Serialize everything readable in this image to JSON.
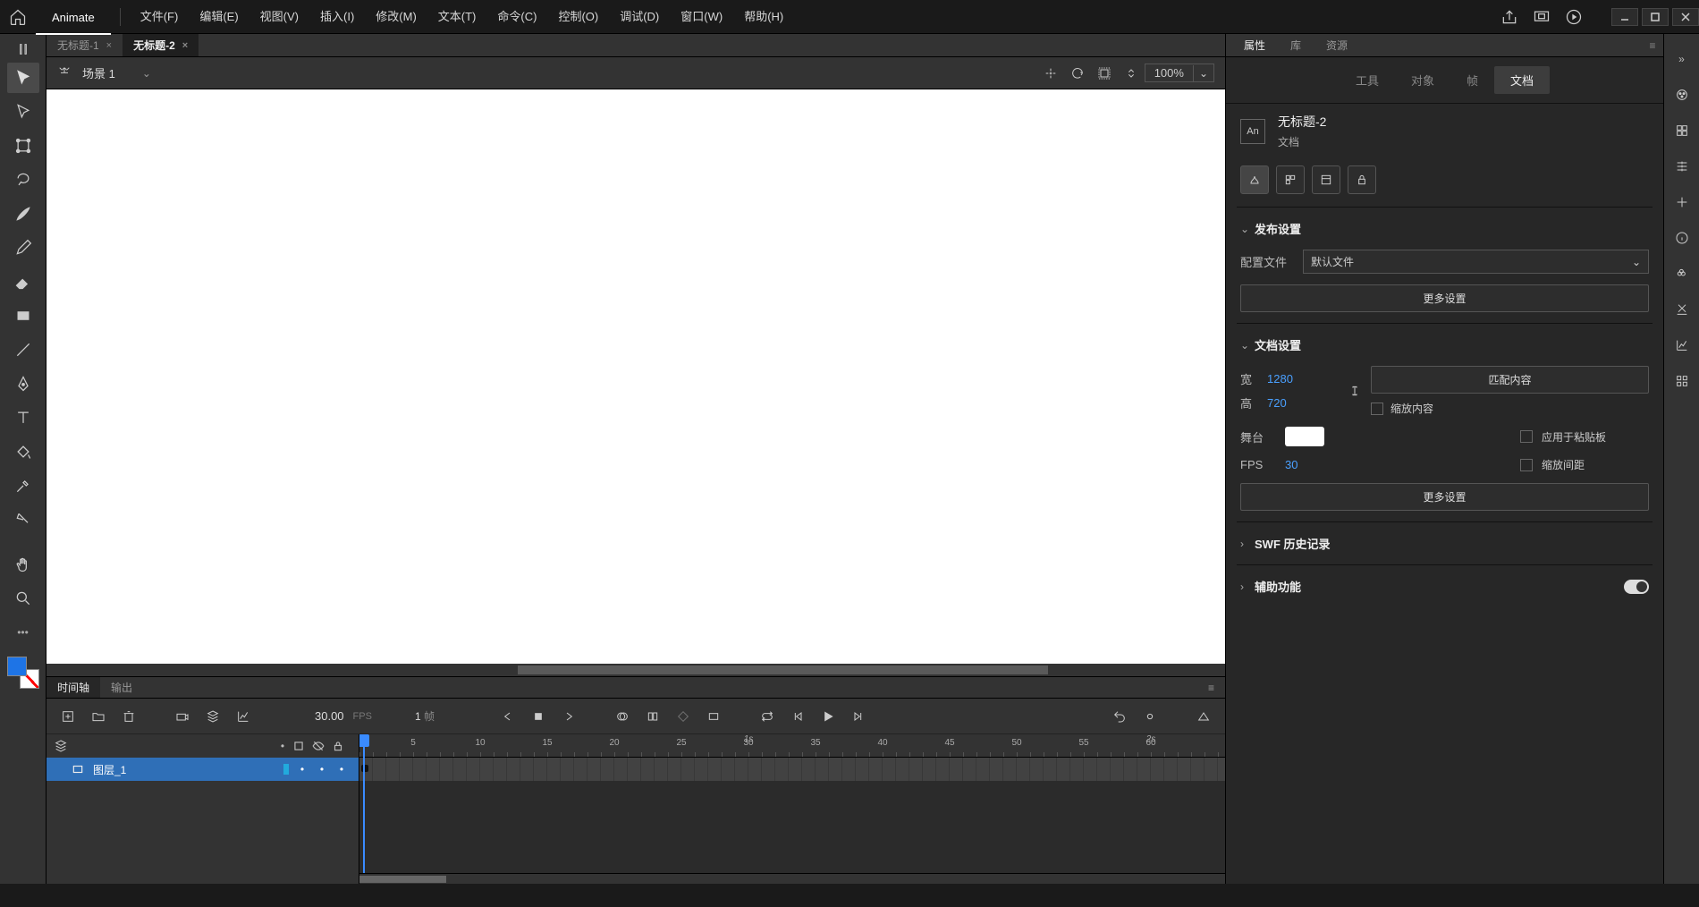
{
  "app": {
    "name": "Animate"
  },
  "menu": {
    "items": [
      "文件(F)",
      "编辑(E)",
      "视图(V)",
      "插入(I)",
      "修改(M)",
      "文本(T)",
      "命令(C)",
      "控制(O)",
      "调试(D)",
      "窗口(W)",
      "帮助(H)"
    ]
  },
  "doc_tabs": [
    {
      "label": "无标题-1",
      "active": false
    },
    {
      "label": "无标题-2",
      "active": true
    }
  ],
  "scene": {
    "label": "场景 1",
    "zoom": "100%"
  },
  "timeline": {
    "tabs": [
      "时间轴",
      "输出"
    ],
    "active_tab": 0,
    "fps": "30.00",
    "fps_label": "FPS",
    "frame": "1",
    "frame_suffix": "帧",
    "layer_name": "图层_1",
    "ruler_ticks": [
      5,
      10,
      15,
      20,
      25,
      30,
      35,
      40,
      45,
      50,
      55,
      60
    ],
    "seconds": {
      "s1": "1s",
      "s2": "2s"
    }
  },
  "right_panel": {
    "tabs": [
      "属性",
      "库",
      "资源"
    ],
    "active": 0,
    "subtabs": [
      "工具",
      "对象",
      "帧",
      "文档"
    ],
    "active_sub": 3,
    "doc_name": "无标题-2",
    "doc_sub": "文档",
    "an_label": "An",
    "sections": {
      "publish": {
        "title": "发布设置",
        "profile_label": "配置文件",
        "profile_value": "默认文件",
        "more": "更多设置"
      },
      "docset": {
        "title": "文档设置",
        "width_label": "宽",
        "width": "1280",
        "height_label": "高",
        "height": "720",
        "match": "匹配内容",
        "scale_content": "缩放内容",
        "stage_label": "舞台",
        "apply_paste": "应用于粘贴板",
        "fps_label": "FPS",
        "fps": "30",
        "scale_spacing": "缩放间距",
        "more": "更多设置"
      },
      "swf": {
        "title": "SWF 历史记录"
      },
      "a11y": {
        "title": "辅助功能"
      }
    }
  }
}
